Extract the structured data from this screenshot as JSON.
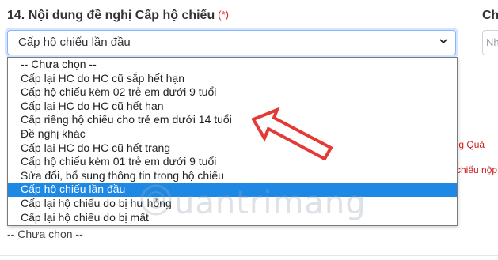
{
  "section": {
    "title": "14. Nội dung đề nghị Cấp hộ chiếu",
    "required_mark": "(*)",
    "right_title": "Ch",
    "right_placeholder": "Nh"
  },
  "select": {
    "value": "Cấp hộ chiếu lần đầu",
    "chevron": "⌄"
  },
  "dropdown": {
    "options": [
      "-- Chưa chọn --",
      "Cấp lại HC do HC cũ sắp hết hạn",
      "Cấp hộ chiếu kèm 02 trẻ em dưới 9 tuổi",
      "Cấp lại HC do HC cũ hết hạn",
      "Cấp riêng hộ chiếu cho trẻ em dưới 14 tuổi",
      "Đề nghị khác",
      "Cấp lại HC do HC cũ hết trang",
      "Cấp hộ chiếu kèm 01 trẻ em dưới 9 tuổi",
      "Sửa đổi, bổ sung thông tin trong hộ chiếu",
      "Cấp hộ chiếu lần đầu",
      "Cấp lại hộ chiếu do bị hư hỏng",
      "Cấp lại hộ chiếu do bị mất"
    ],
    "selected_index": 9
  },
  "background_text": {
    "red_1": "ông Quả",
    "red_2": "chiếu nộp"
  },
  "bottom_select": {
    "value": "-- Chưa chọn --"
  },
  "watermark": {
    "text": "uantrimang"
  },
  "colors": {
    "selected_bg": "#1e88e5",
    "annotation_arrow": "#e53935",
    "required": "#e02020"
  }
}
